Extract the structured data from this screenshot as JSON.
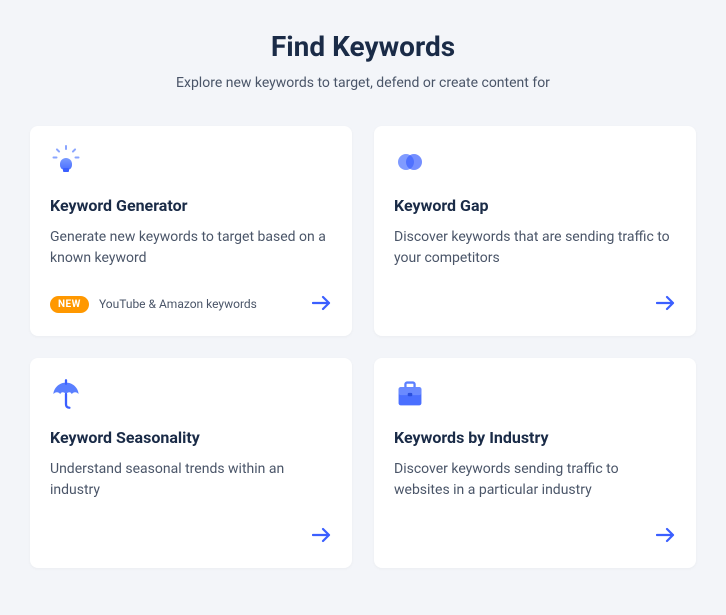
{
  "header": {
    "title": "Find Keywords",
    "subtitle": "Explore new keywords to target, defend or create content for"
  },
  "cards": [
    {
      "title": "Keyword Generator",
      "description": "Generate new keywords to target based on a known keyword",
      "badge": "NEW",
      "badge_text": "YouTube & Amazon keywords"
    },
    {
      "title": "Keyword Gap",
      "description": "Discover keywords that are sending traffic to your competitors"
    },
    {
      "title": "Keyword Seasonality",
      "description": "Understand seasonal trends within an industry"
    },
    {
      "title": "Keywords by Industry",
      "description": "Discover keywords sending traffic to websites in a particular industry"
    }
  ]
}
